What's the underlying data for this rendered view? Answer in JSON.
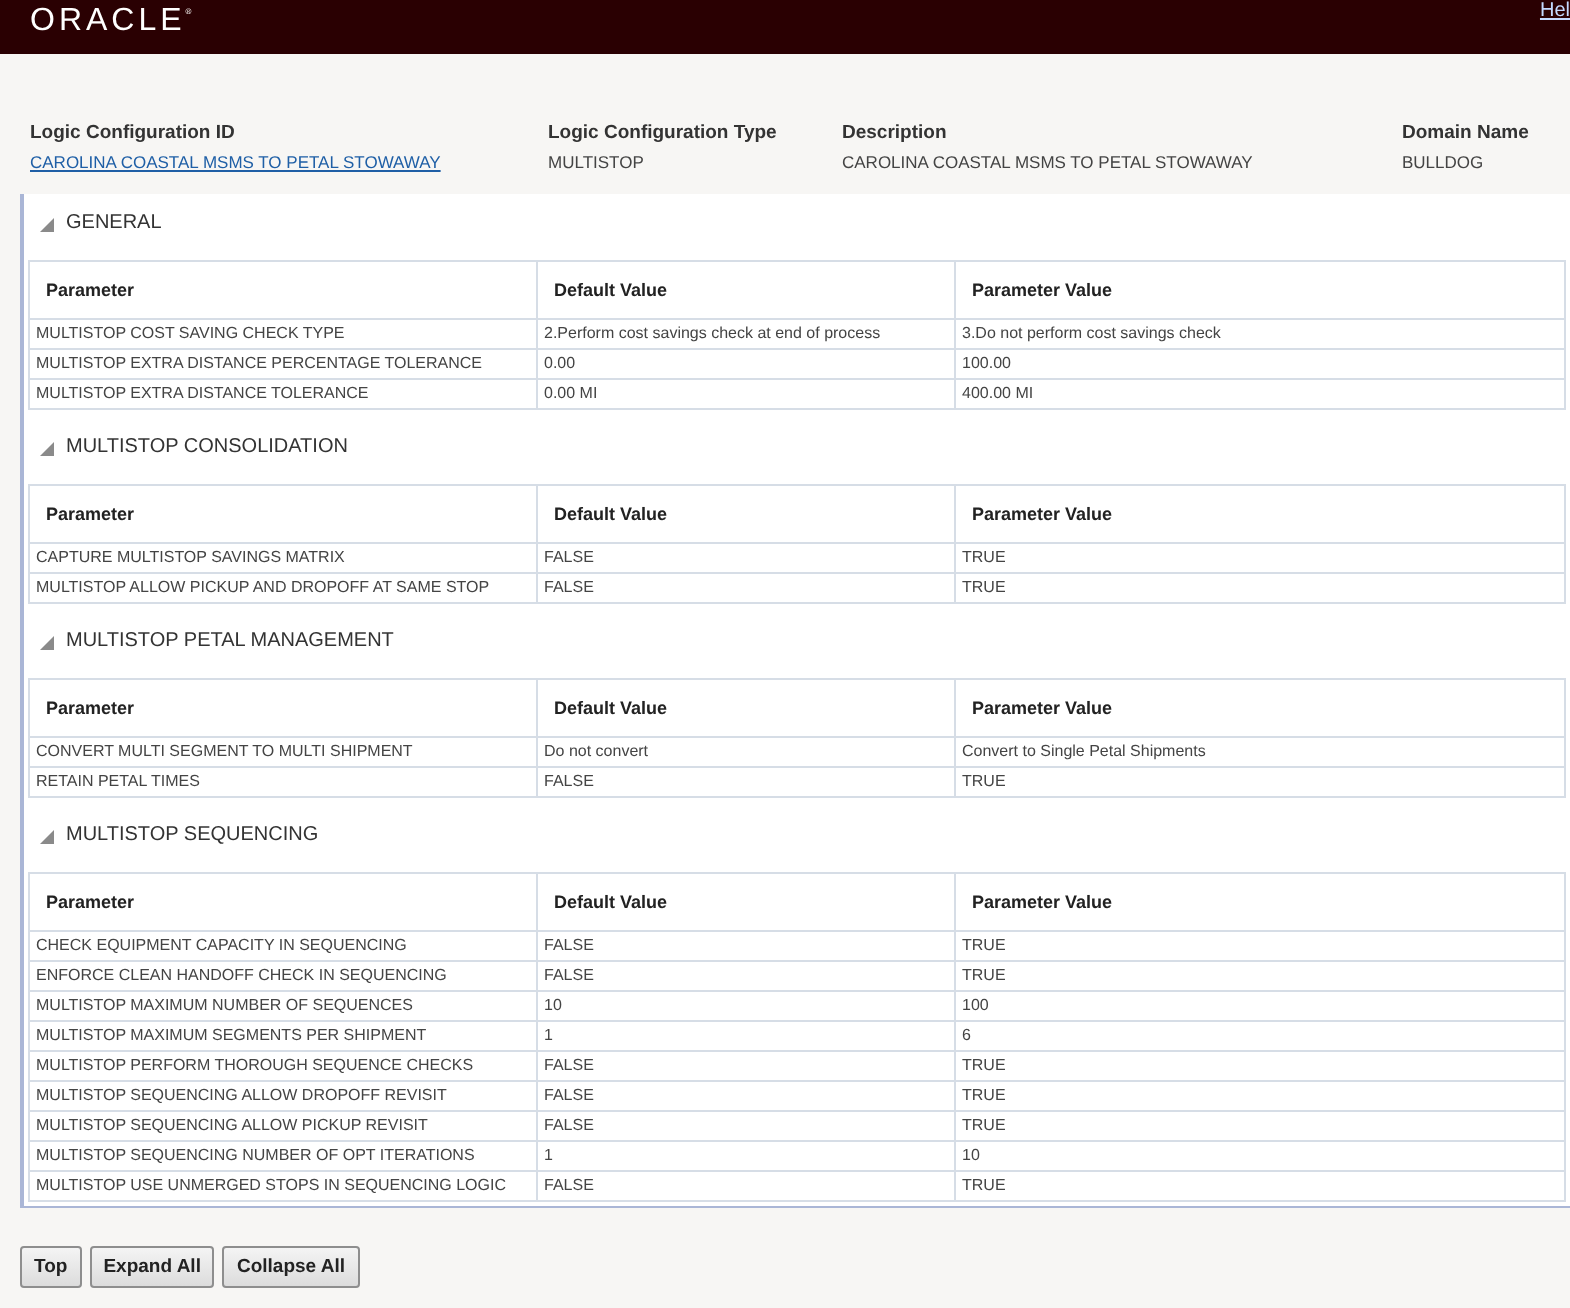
{
  "header": {
    "logo": "ORACLE$^{®}$",
    "help_link": "Hel"
  },
  "summary": [
    {
      "label": "Logic Configuration ID",
      "value": "CAROLINA COASTAL MSMS TO PETAL STOWAWAY",
      "kind": "link"
    },
    {
      "label": "Logic Configuration Type",
      "value": "MULTISTOP",
      "kind": "text"
    },
    {
      "label": "Description",
      "value": "CAROLINA COASTAL MSMS TO PETAL STOWAWAY",
      "kind": "text"
    },
    {
      "label": "Domain Name",
      "value": "BULLDOG",
      "kind": "text"
    }
  ],
  "sections": [
    {
      "title": "GENERAL",
      "expanded": true,
      "columns": [
        "Parameter",
        "Default Value",
        "Parameter Value"
      ],
      "rows": [
        [
          "MULTISTOP COST SAVING CHECK TYPE",
          "2.Perform cost savings check at end of process",
          "3.Do not perform cost savings check"
        ],
        [
          "MULTISTOP EXTRA DISTANCE PERCENTAGE TOLERANCE",
          "0.00",
          "100.00"
        ],
        [
          "MULTISTOP EXTRA DISTANCE TOLERANCE",
          "0.00 MI",
          "400.00 MI"
        ]
      ]
    },
    {
      "title": "MULTISTOP CONSOLIDATION",
      "expanded": true,
      "columns": [
        "Parameter",
        "Default Value",
        "Parameter Value"
      ],
      "rows": [
        [
          "CAPTURE MULTISTOP SAVINGS MATRIX",
          "FALSE",
          "TRUE"
        ],
        [
          "MULTISTOP ALLOW PICKUP AND DROPOFF AT SAME STOP",
          "FALSE",
          "TRUE"
        ]
      ]
    },
    {
      "title": "MULTISTOP PETAL MANAGEMENT",
      "expanded": true,
      "columns": [
        "Parameter",
        "Default Value",
        "Parameter Value"
      ],
      "rows": [
        [
          "CONVERT MULTI SEGMENT TO MULTI SHIPMENT",
          "Do not convert",
          "Convert to Single Petal Shipments"
        ],
        [
          "RETAIN PETAL TIMES",
          "FALSE",
          "TRUE"
        ]
      ]
    },
    {
      "title": "MULTISTOP SEQUENCING",
      "expanded": true,
      "columns": [
        "Parameter",
        "Default Value",
        "Parameter Value"
      ],
      "rows": [
        [
          "CHECK EQUIPMENT CAPACITY IN SEQUENCING",
          "FALSE",
          "TRUE"
        ],
        [
          "ENFORCE CLEAN HANDOFF CHECK IN SEQUENCING",
          "FALSE",
          "TRUE"
        ],
        [
          "MULTISTOP MAXIMUM NUMBER OF SEQUENCES",
          "10",
          "100"
        ],
        [
          "MULTISTOP MAXIMUM SEGMENTS PER SHIPMENT",
          "1",
          "6"
        ],
        [
          "MULTISTOP PERFORM THOROUGH SEQUENCE CHECKS",
          "FALSE",
          "TRUE"
        ],
        [
          "MULTISTOP SEQUENCING ALLOW DROPOFF REVISIT",
          "FALSE",
          "TRUE"
        ],
        [
          "MULTISTOP SEQUENCING ALLOW PICKUP REVISIT",
          "FALSE",
          "TRUE"
        ],
        [
          "MULTISTOP SEQUENCING NUMBER OF OPT ITERATIONS",
          "1",
          "10"
        ],
        [
          "MULTISTOP USE UNMERGED STOPS IN SEQUENCING LOGIC",
          "FALSE",
          "TRUE"
        ]
      ]
    }
  ],
  "buttons": [
    "Top",
    "Expand All",
    "Collapse All"
  ]
}
